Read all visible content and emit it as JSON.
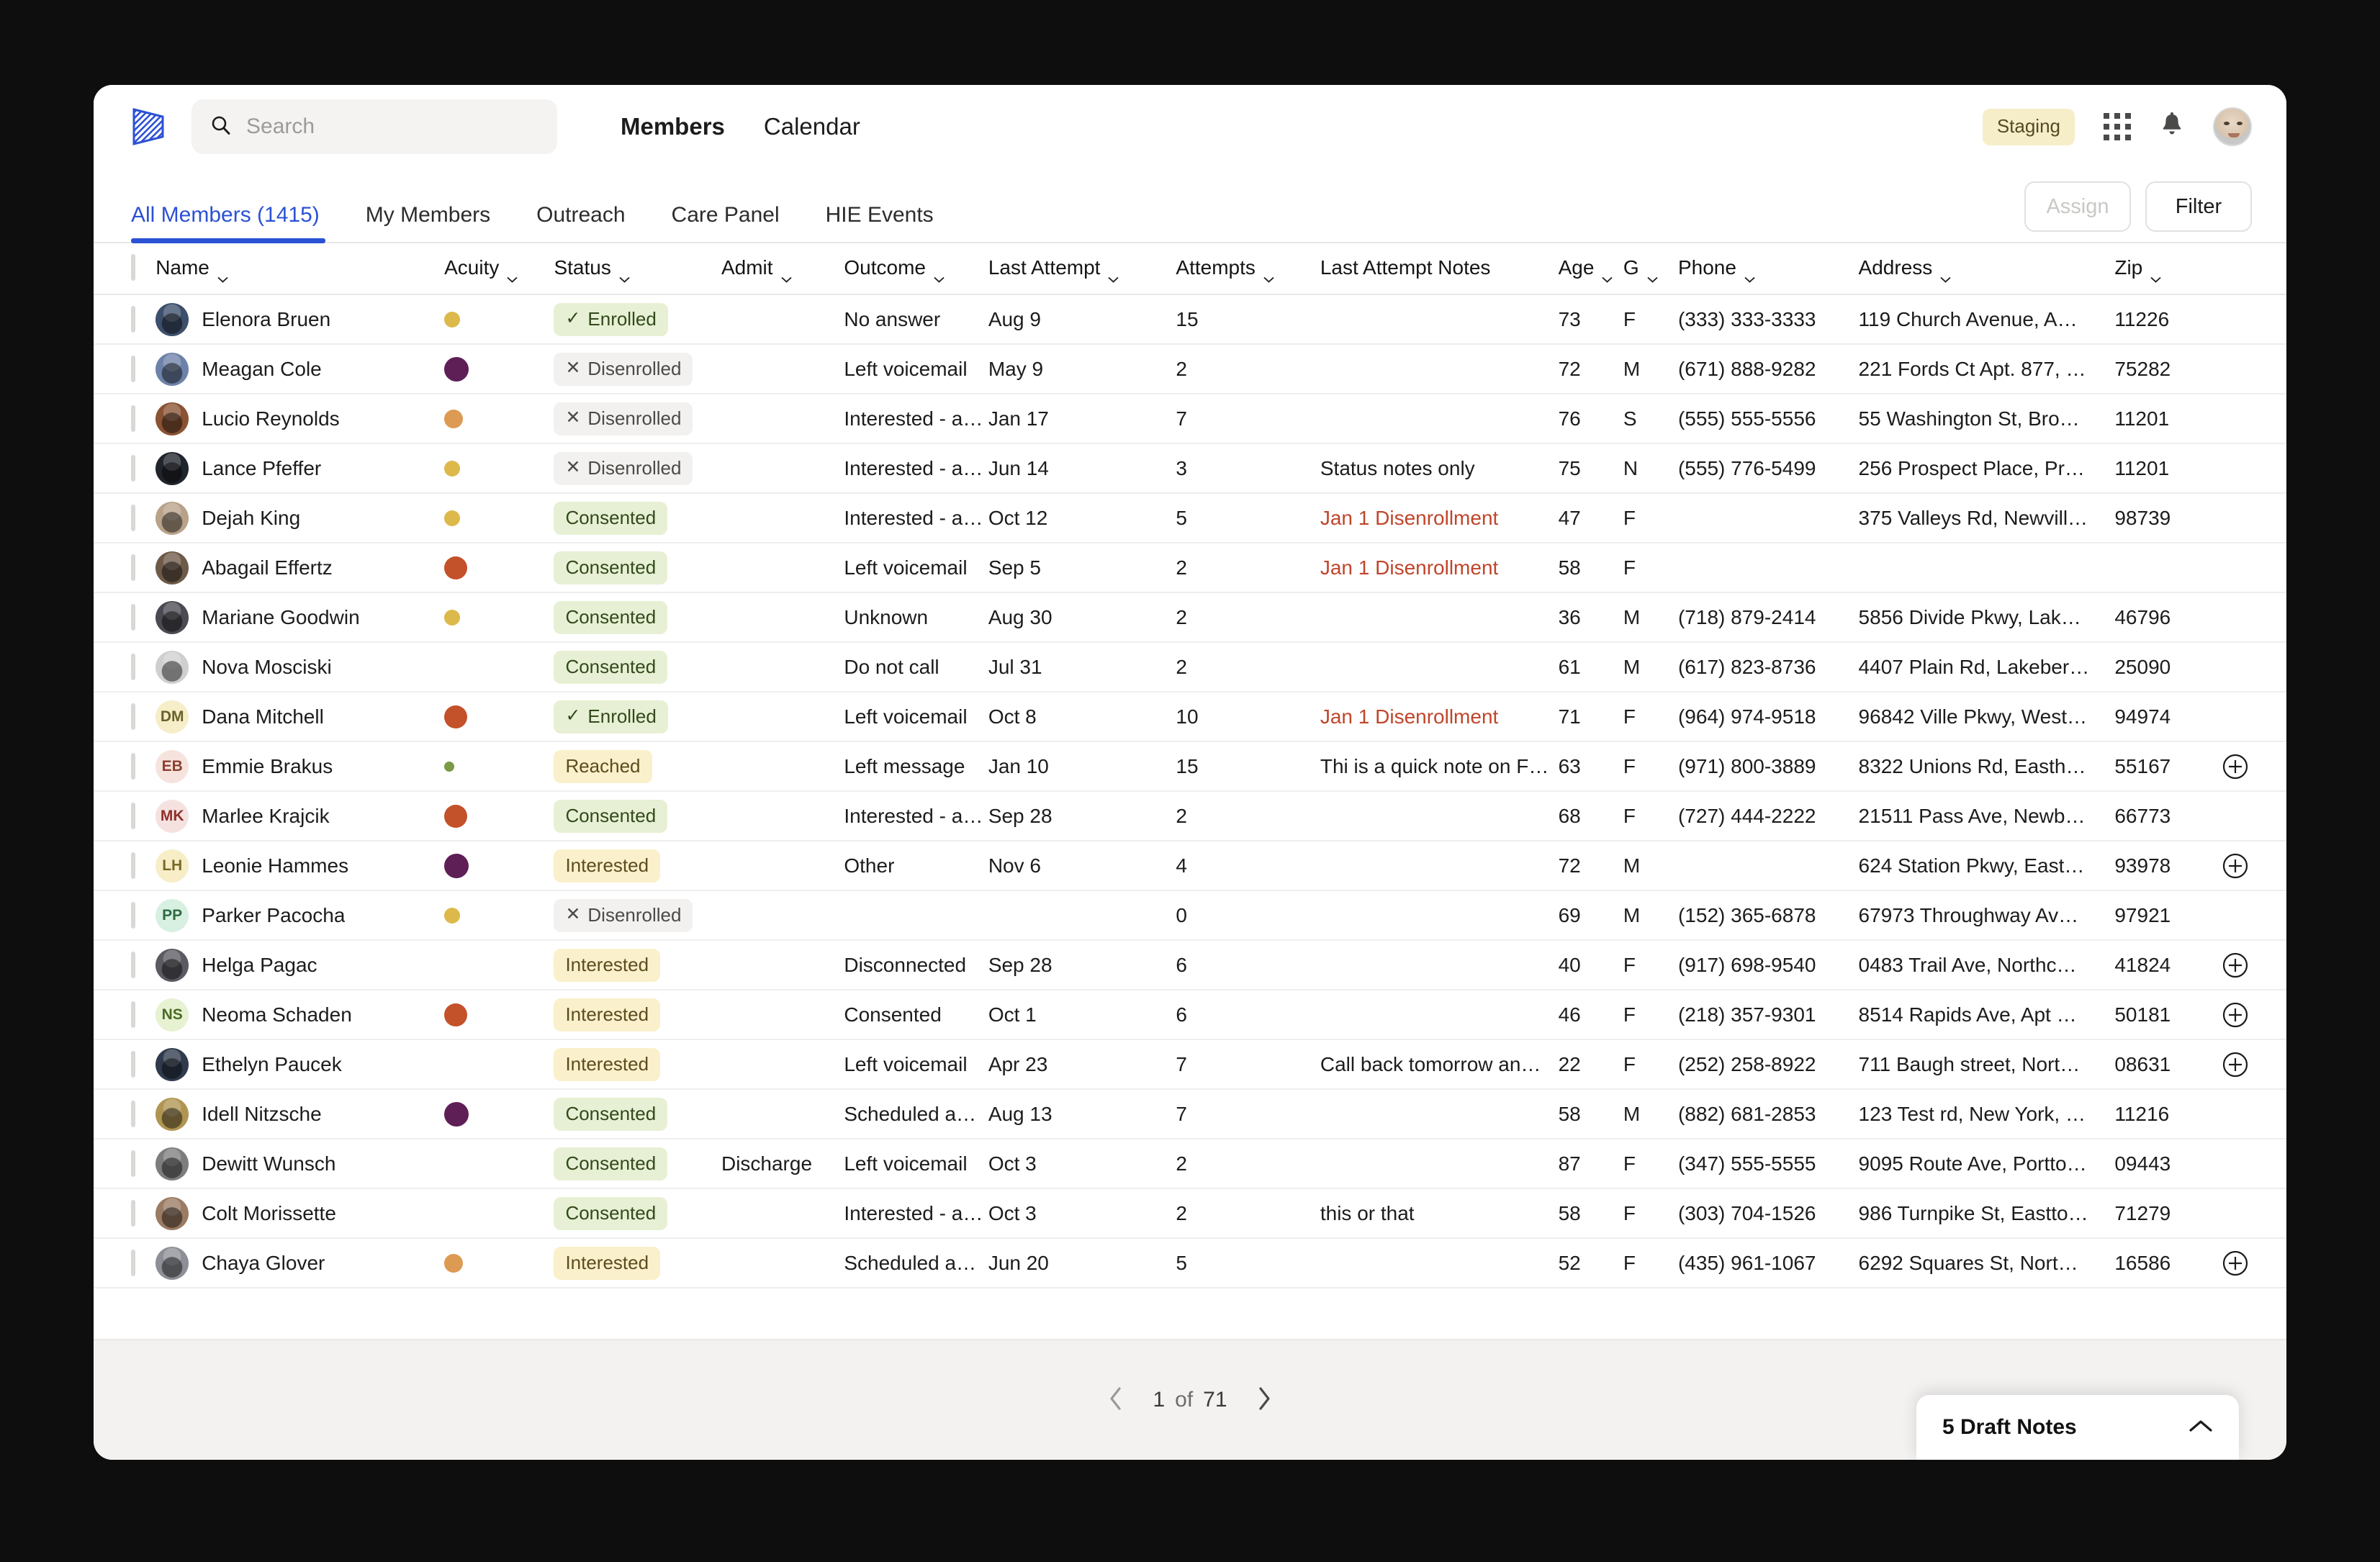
{
  "app": {
    "logo_icon": "striped-flag-logo",
    "staging_badge": "Staging",
    "grid_icon": "apps-grid-icon",
    "bell_icon": "notification-bell-icon",
    "avatar_icon": "user-avatar"
  },
  "search": {
    "value": "",
    "placeholder": "Search",
    "icon": "search-icon"
  },
  "nav": {
    "links": [
      {
        "label": "Members",
        "active": true
      },
      {
        "label": "Calendar",
        "active": false
      }
    ]
  },
  "tabs": [
    {
      "label": "All Members (1415)",
      "active": true
    },
    {
      "label": "My Members",
      "active": false
    },
    {
      "label": "Outreach",
      "active": false
    },
    {
      "label": "Care Panel",
      "active": false
    },
    {
      "label": "HIE Events",
      "active": false
    }
  ],
  "actions": {
    "assign": "Assign",
    "filter": "Filter"
  },
  "columns": [
    {
      "label": "Name",
      "sortable": true
    },
    {
      "label": "Acuity",
      "sortable": true
    },
    {
      "label": "Status",
      "sortable": true
    },
    {
      "label": "Admit",
      "sortable": true
    },
    {
      "label": "Outcome",
      "sortable": true
    },
    {
      "label": "Last Attempt",
      "sortable": true
    },
    {
      "label": "Attempts",
      "sortable": true
    },
    {
      "label": "Last Attempt Notes",
      "sortable": false
    },
    {
      "label": "Age",
      "sortable": true
    },
    {
      "label": "G",
      "sortable": true
    },
    {
      "label": "Phone",
      "sortable": true
    },
    {
      "label": "Address",
      "sortable": true
    },
    {
      "label": "Zip",
      "sortable": true
    }
  ],
  "colors": {
    "accent": "#2b51d4",
    "acuity_gold": "#dcb94a",
    "acuity_orange": "#dd9a53",
    "acuity_red": "#c3512a",
    "acuity_purple": "#5d1f55",
    "acuity_green": "#7a9a45",
    "notes_alert": "#c0452a",
    "badge_green_bg": "#e7f0d4",
    "badge_cream_bg": "#faf0cb",
    "badge_grey_bg": "#f2f1ef",
    "staging_bg": "#f6eec9"
  },
  "rows": [
    {
      "name": "Elenora Bruen",
      "avatar_type": "photo",
      "avatar_bg": "#3c4f6b",
      "acuity": {
        "color": "#dcb94a",
        "size": 22
      },
      "status": {
        "label": "Enrolled",
        "tone": "green",
        "icon": "check"
      },
      "admit": "",
      "outcome": "No answer",
      "last_attempt": "Aug 9",
      "attempts": "15",
      "notes": "",
      "notes_alert": false,
      "age": "73",
      "gender": "F",
      "phone": "(333) 333-3333",
      "address": "119 Church Avenue, A…",
      "zip": "11226",
      "add_note": false
    },
    {
      "name": "Meagan Cole",
      "avatar_type": "photo",
      "avatar_bg": "#6d82a8",
      "acuity": {
        "color": "#5d1f55",
        "size": 34
      },
      "status": {
        "label": "Disenrolled",
        "tone": "grey",
        "icon": "cross"
      },
      "admit": "",
      "outcome": "Left voicemail",
      "last_attempt": "May 9",
      "attempts": "2",
      "notes": "",
      "notes_alert": false,
      "age": "72",
      "gender": "M",
      "phone": "(671) 888-9282",
      "address": "221 Fords Ct Apt. 877, …",
      "zip": "75282",
      "add_note": false
    },
    {
      "name": "Lucio Reynolds",
      "avatar_type": "photo",
      "avatar_bg": "#8a5334",
      "acuity": {
        "color": "#dd9a53",
        "size": 26
      },
      "status": {
        "label": "Disenrolled",
        "tone": "grey",
        "icon": "cross"
      },
      "admit": "",
      "outcome": "Interested - a…",
      "last_attempt": "Jan 17",
      "attempts": "7",
      "notes": "",
      "notes_alert": false,
      "age": "76",
      "gender": "S",
      "phone": "(555) 555-5556",
      "address": "55 Washington St, Bro…",
      "zip": "11201",
      "add_note": false
    },
    {
      "name": "Lance Pfeffer",
      "avatar_type": "photo",
      "avatar_bg": "#20242b",
      "acuity": {
        "color": "#dcb94a",
        "size": 22
      },
      "status": {
        "label": "Disenrolled",
        "tone": "grey",
        "icon": "cross"
      },
      "admit": "",
      "outcome": "Interested - a…",
      "last_attempt": "Jun 14",
      "attempts": "3",
      "notes": "Status notes only",
      "notes_alert": false,
      "age": "75",
      "gender": "N",
      "phone": "(555) 776-5499",
      "address": "256 Prospect Place, Pr…",
      "zip": "11201",
      "add_note": false
    },
    {
      "name": "Dejah King",
      "avatar_type": "photo",
      "avatar_bg": "#b8a289",
      "acuity": {
        "color": "#dcb94a",
        "size": 22
      },
      "status": {
        "label": "Consented",
        "tone": "green",
        "icon": "none"
      },
      "admit": "",
      "outcome": "Interested - a…",
      "last_attempt": "Oct 12",
      "attempts": "5",
      "notes": "Jan 1 Disenrollment",
      "notes_alert": true,
      "age": "47",
      "gender": "F",
      "phone": "",
      "address": "375 Valleys Rd, Newvill…",
      "zip": "98739",
      "add_note": false
    },
    {
      "name": "Abagail Effertz",
      "avatar_type": "photo",
      "avatar_bg": "#6e5a48",
      "acuity": {
        "color": "#c3512a",
        "size": 32
      },
      "status": {
        "label": "Consented",
        "tone": "green",
        "icon": "none"
      },
      "admit": "",
      "outcome": "Left voicemail",
      "last_attempt": "Sep 5",
      "attempts": "2",
      "notes": "Jan 1 Disenrollment",
      "notes_alert": true,
      "age": "58",
      "gender": "F",
      "phone": "",
      "address": "",
      "zip": "",
      "add_note": false
    },
    {
      "name": "Mariane Goodwin",
      "avatar_type": "photo",
      "avatar_bg": "#4a4a52",
      "acuity": {
        "color": "#dcb94a",
        "size": 22
      },
      "status": {
        "label": "Consented",
        "tone": "green",
        "icon": "none"
      },
      "admit": "",
      "outcome": "Unknown",
      "last_attempt": "Aug 30",
      "attempts": "2",
      "notes": "",
      "notes_alert": false,
      "age": "36",
      "gender": "M",
      "phone": "(718) 879-2414",
      "address": "5856 Divide Pkwy, Lak…",
      "zip": "46796",
      "add_note": false
    },
    {
      "name": "Nova Mosciski",
      "avatar_type": "photo",
      "avatar_bg": "#cfcfcf",
      "acuity": {
        "color": "",
        "size": 0
      },
      "status": {
        "label": "Consented",
        "tone": "green",
        "icon": "none"
      },
      "admit": "",
      "outcome": "Do not call",
      "last_attempt": "Jul 31",
      "attempts": "2",
      "notes": "",
      "notes_alert": false,
      "age": "61",
      "gender": "M",
      "phone": "(617) 823-8736",
      "address": "4407 Plain Rd, Lakeber…",
      "zip": "25090",
      "add_note": false
    },
    {
      "name": "Dana Mitchell",
      "avatar_type": "initials",
      "initials": "DM",
      "avatar_bg": "#f6eec9",
      "avatar_fg": "#6a6029",
      "acuity": {
        "color": "#c3512a",
        "size": 32
      },
      "status": {
        "label": "Enrolled",
        "tone": "green",
        "icon": "check"
      },
      "admit": "",
      "outcome": "Left voicemail",
      "last_attempt": "Oct 8",
      "attempts": "10",
      "notes": "Jan 1 Disenrollment",
      "notes_alert": true,
      "age": "71",
      "gender": "F",
      "phone": "(964) 974-9518",
      "address": "96842 Ville Pkwy, West…",
      "zip": "94974",
      "add_note": false
    },
    {
      "name": "Emmie Brakus",
      "avatar_type": "initials",
      "initials": "EB",
      "avatar_bg": "#f7e3de",
      "avatar_fg": "#8e4030",
      "acuity": {
        "color": "#7a9a45",
        "size": 14
      },
      "status": {
        "label": "Reached",
        "tone": "cream",
        "icon": "none"
      },
      "admit": "",
      "outcome": "Left message",
      "last_attempt": "Jan 10",
      "attempts": "15",
      "notes": "Thi is a quick note on F…",
      "notes_alert": false,
      "age": "63",
      "gender": "F",
      "phone": "(971) 800-3889",
      "address": "8322 Unions Rd, Easth…",
      "zip": "55167",
      "add_note": true
    },
    {
      "name": "Marlee Krajcik",
      "avatar_type": "initials",
      "initials": "MK",
      "avatar_bg": "#f5e2e0",
      "avatar_fg": "#8f2f2a",
      "acuity": {
        "color": "#c3512a",
        "size": 32
      },
      "status": {
        "label": "Consented",
        "tone": "green",
        "icon": "none"
      },
      "admit": "",
      "outcome": "Interested - a…",
      "last_attempt": "Sep 28",
      "attempts": "2",
      "notes": "",
      "notes_alert": false,
      "age": "68",
      "gender": "F",
      "phone": "(727) 444-2222",
      "address": "21511 Pass Ave, Newb…",
      "zip": "66773",
      "add_note": false
    },
    {
      "name": "Leonie Hammes",
      "avatar_type": "initials",
      "initials": "LH",
      "avatar_bg": "#f7eec8",
      "avatar_fg": "#7a6a24",
      "acuity": {
        "color": "#5d1f55",
        "size": 34
      },
      "status": {
        "label": "Interested",
        "tone": "cream",
        "icon": "none"
      },
      "admit": "",
      "outcome": "Other",
      "last_attempt": "Nov 6",
      "attempts": "4",
      "notes": "",
      "notes_alert": false,
      "age": "72",
      "gender": "M",
      "phone": "",
      "address": "624 Station Pkwy, East…",
      "zip": "93978",
      "add_note": true
    },
    {
      "name": "Parker Pacocha",
      "avatar_type": "initials",
      "initials": "PP",
      "avatar_bg": "#d8f0e1",
      "avatar_fg": "#2f6a44",
      "acuity": {
        "color": "#dcb94a",
        "size": 22
      },
      "status": {
        "label": "Disenrolled",
        "tone": "grey",
        "icon": "cross"
      },
      "admit": "",
      "outcome": "",
      "last_attempt": "",
      "attempts": "0",
      "notes": "",
      "notes_alert": false,
      "age": "69",
      "gender": "M",
      "phone": "(152) 365-6878",
      "address": "67973 Throughway Av…",
      "zip": "97921",
      "add_note": false
    },
    {
      "name": "Helga Pagac",
      "avatar_type": "photo",
      "avatar_bg": "#5a5a62",
      "acuity": {
        "color": "",
        "size": 0
      },
      "status": {
        "label": "Interested",
        "tone": "cream",
        "icon": "none"
      },
      "admit": "",
      "outcome": "Disconnected",
      "last_attempt": "Sep 28",
      "attempts": "6",
      "notes": "",
      "notes_alert": false,
      "age": "40",
      "gender": "F",
      "phone": "(917) 698-9540",
      "address": "0483 Trail Ave, Northc…",
      "zip": "41824",
      "add_note": true
    },
    {
      "name": "Neoma Schaden",
      "avatar_type": "initials",
      "initials": "NS",
      "avatar_bg": "#e6f2d2",
      "avatar_fg": "#4a6b22",
      "acuity": {
        "color": "#c3512a",
        "size": 32
      },
      "status": {
        "label": "Interested",
        "tone": "cream",
        "icon": "none"
      },
      "admit": "",
      "outcome": "Consented",
      "last_attempt": "Oct 1",
      "attempts": "6",
      "notes": "",
      "notes_alert": false,
      "age": "46",
      "gender": "F",
      "phone": "(218) 357-9301",
      "address": "8514 Rapids Ave, Apt …",
      "zip": "50181",
      "add_note": true
    },
    {
      "name": "Ethelyn Paucek",
      "avatar_type": "photo",
      "avatar_bg": "#2f3a4c",
      "acuity": {
        "color": "",
        "size": 0
      },
      "status": {
        "label": "Interested",
        "tone": "cream",
        "icon": "none"
      },
      "admit": "",
      "outcome": "Left voicemail",
      "last_attempt": "Apr 23",
      "attempts": "7",
      "notes": "Call back tomorrow an…",
      "notes_alert": false,
      "age": "22",
      "gender": "F",
      "phone": "(252) 258-8922",
      "address": "711 Baugh street, Nort…",
      "zip": "08631",
      "add_note": true
    },
    {
      "name": "Idell Nitzsche",
      "avatar_type": "photo",
      "avatar_bg": "#b09552",
      "acuity": {
        "color": "#5d1f55",
        "size": 34
      },
      "status": {
        "label": "Consented",
        "tone": "green",
        "icon": "none"
      },
      "admit": "",
      "outcome": "Scheduled a…",
      "last_attempt": "Aug 13",
      "attempts": "7",
      "notes": "",
      "notes_alert": false,
      "age": "58",
      "gender": "M",
      "phone": "(882) 681-2853",
      "address": "123 Test rd, New York, …",
      "zip": "11216",
      "add_note": false
    },
    {
      "name": "Dewitt Wunsch",
      "avatar_type": "photo",
      "avatar_bg": "#7d7d7d",
      "acuity": {
        "color": "",
        "size": 0
      },
      "status": {
        "label": "Consented",
        "tone": "green",
        "icon": "none"
      },
      "admit": "Discharge",
      "outcome": "Left voicemail",
      "last_attempt": "Oct 3",
      "attempts": "2",
      "notes": "",
      "notes_alert": false,
      "age": "87",
      "gender": "F",
      "phone": "(347) 555-5555",
      "address": "9095 Route Ave, Portto…",
      "zip": "09443",
      "add_note": false
    },
    {
      "name": "Colt Morissette",
      "avatar_type": "photo",
      "avatar_bg": "#9a7b63",
      "acuity": {
        "color": "",
        "size": 0
      },
      "status": {
        "label": "Consented",
        "tone": "green",
        "icon": "none"
      },
      "admit": "",
      "outcome": "Interested - a…",
      "last_attempt": "Oct 3",
      "attempts": "2",
      "notes": "this or that",
      "notes_alert": false,
      "age": "58",
      "gender": "F",
      "phone": "(303) 704-1526",
      "address": "986 Turnpike St, Eastto…",
      "zip": "71279",
      "add_note": false
    },
    {
      "name": "Chaya Glover",
      "avatar_type": "photo",
      "avatar_bg": "#8d8f96",
      "acuity": {
        "color": "#dd9a53",
        "size": 26
      },
      "status": {
        "label": "Interested",
        "tone": "cream",
        "icon": "none"
      },
      "admit": "",
      "outcome": "Scheduled a…",
      "last_attempt": "Jun 20",
      "attempts": "5",
      "notes": "",
      "notes_alert": false,
      "age": "52",
      "gender": "F",
      "phone": "(435) 961-1067",
      "address": "6292 Squares St, Nort…",
      "zip": "16586",
      "add_note": true
    }
  ],
  "pagination": {
    "prev_icon": "chevron-left-icon",
    "next_icon": "chevron-right-icon",
    "current": "1",
    "separator": "of",
    "total": "71"
  },
  "draft_notes": {
    "label": "5 Draft Notes",
    "chevron_icon": "chevron-up-icon"
  }
}
